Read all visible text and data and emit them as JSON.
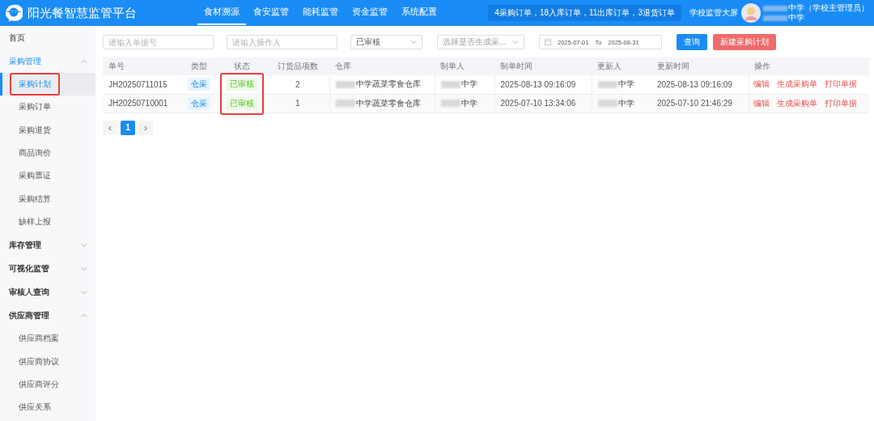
{
  "header": {
    "title": "阳光餐智慧监管平台",
    "nav": [
      {
        "label": "食材溯源",
        "selected": true
      },
      {
        "label": "食安监管",
        "selected": false
      },
      {
        "label": "能耗监管",
        "selected": false
      },
      {
        "label": "资金监管",
        "selected": false
      },
      {
        "label": "系统配置",
        "selected": false
      }
    ],
    "notice": "4采购订单，18入库订单，11出库订单，3退货订单",
    "big_screen": "学校监管大屏",
    "user": {
      "name": "中学（学校主管理员）",
      "org": "中学",
      "redacted": true
    }
  },
  "sidebar": [
    {
      "label": "首页",
      "kind": "item",
      "selected": false
    },
    {
      "label": "采购管理",
      "kind": "group",
      "expanded": true,
      "selected": true,
      "children": [
        {
          "label": "采购计划",
          "selected": true,
          "highlighted": true
        },
        {
          "label": "采购订单",
          "selected": false,
          "highlighted": false
        },
        {
          "label": "采购退货",
          "selected": false,
          "highlighted": false
        },
        {
          "label": "商品询价",
          "selected": false,
          "highlighted": false
        },
        {
          "label": "采购票证",
          "selected": false,
          "highlighted": false
        },
        {
          "label": "采购结算",
          "selected": false,
          "highlighted": false
        },
        {
          "label": "缺样上报",
          "selected": false,
          "highlighted": false
        }
      ]
    },
    {
      "label": "库存管理",
      "kind": "group",
      "expanded": false,
      "selected": false
    },
    {
      "label": "可视化监管",
      "kind": "group",
      "expanded": false,
      "selected": false
    },
    {
      "label": "审核人查询",
      "kind": "group",
      "expanded": false,
      "selected": false
    },
    {
      "label": "供应商管理",
      "kind": "group",
      "expanded": true,
      "selected": false,
      "children": [
        {
          "label": "供应商档案",
          "selected": false,
          "highlighted": false
        },
        {
          "label": "供应商协议",
          "selected": false,
          "highlighted": false
        },
        {
          "label": "供应商评分",
          "selected": false,
          "highlighted": false
        },
        {
          "label": "供应关系",
          "selected": false,
          "highlighted": false
        }
      ]
    }
  ],
  "filters": [
    {
      "kind": "input",
      "placeholder": "请输入单据号"
    },
    {
      "kind": "input",
      "placeholder": "请输入操作人"
    },
    {
      "kind": "select",
      "value": "已审核"
    },
    {
      "kind": "select",
      "placeholder": "选择是否生成采..."
    },
    {
      "kind": "daterange",
      "start": "2025-07-01",
      "separator": "To",
      "end": "2025-08-31"
    }
  ],
  "buttons": [
    {
      "label": "查询",
      "kind": "primary"
    },
    {
      "label": "新建采购计划",
      "kind": "danger"
    }
  ],
  "table": {
    "columns": [
      "单号",
      "类型",
      "状态",
      "订货品项数",
      "仓库",
      "制单人",
      "制单时间",
      "更新人",
      "更新时间",
      "操作"
    ],
    "status_highlighted": true,
    "rows": [
      {
        "number": "JH20250711015",
        "type": "仓采",
        "status": "已审核",
        "items": "2",
        "warehouse": "中学蔬菜零食仓库",
        "creator": "中学",
        "created": "2025-08-13 09:16:09",
        "updater": "中学",
        "updated": "2025-08-13 09:16:09",
        "actions": [
          "编辑",
          "生成采购单",
          "打印单据"
        ]
      },
      {
        "number": "JH20250710001",
        "type": "仓采",
        "status": "已审核",
        "items": "1",
        "warehouse": "中学蔬菜零食仓库",
        "creator": "中学",
        "created": "2025-07-10 13:34:06",
        "updater": "中学",
        "updated": "2025-07-10 21:46:29",
        "actions": [
          "编辑",
          "生成采购单",
          "打印单据"
        ]
      }
    ]
  },
  "pagination": {
    "prev": "‹",
    "pages": [
      {
        "label": "1",
        "selected": true
      }
    ],
    "next": "›"
  }
}
